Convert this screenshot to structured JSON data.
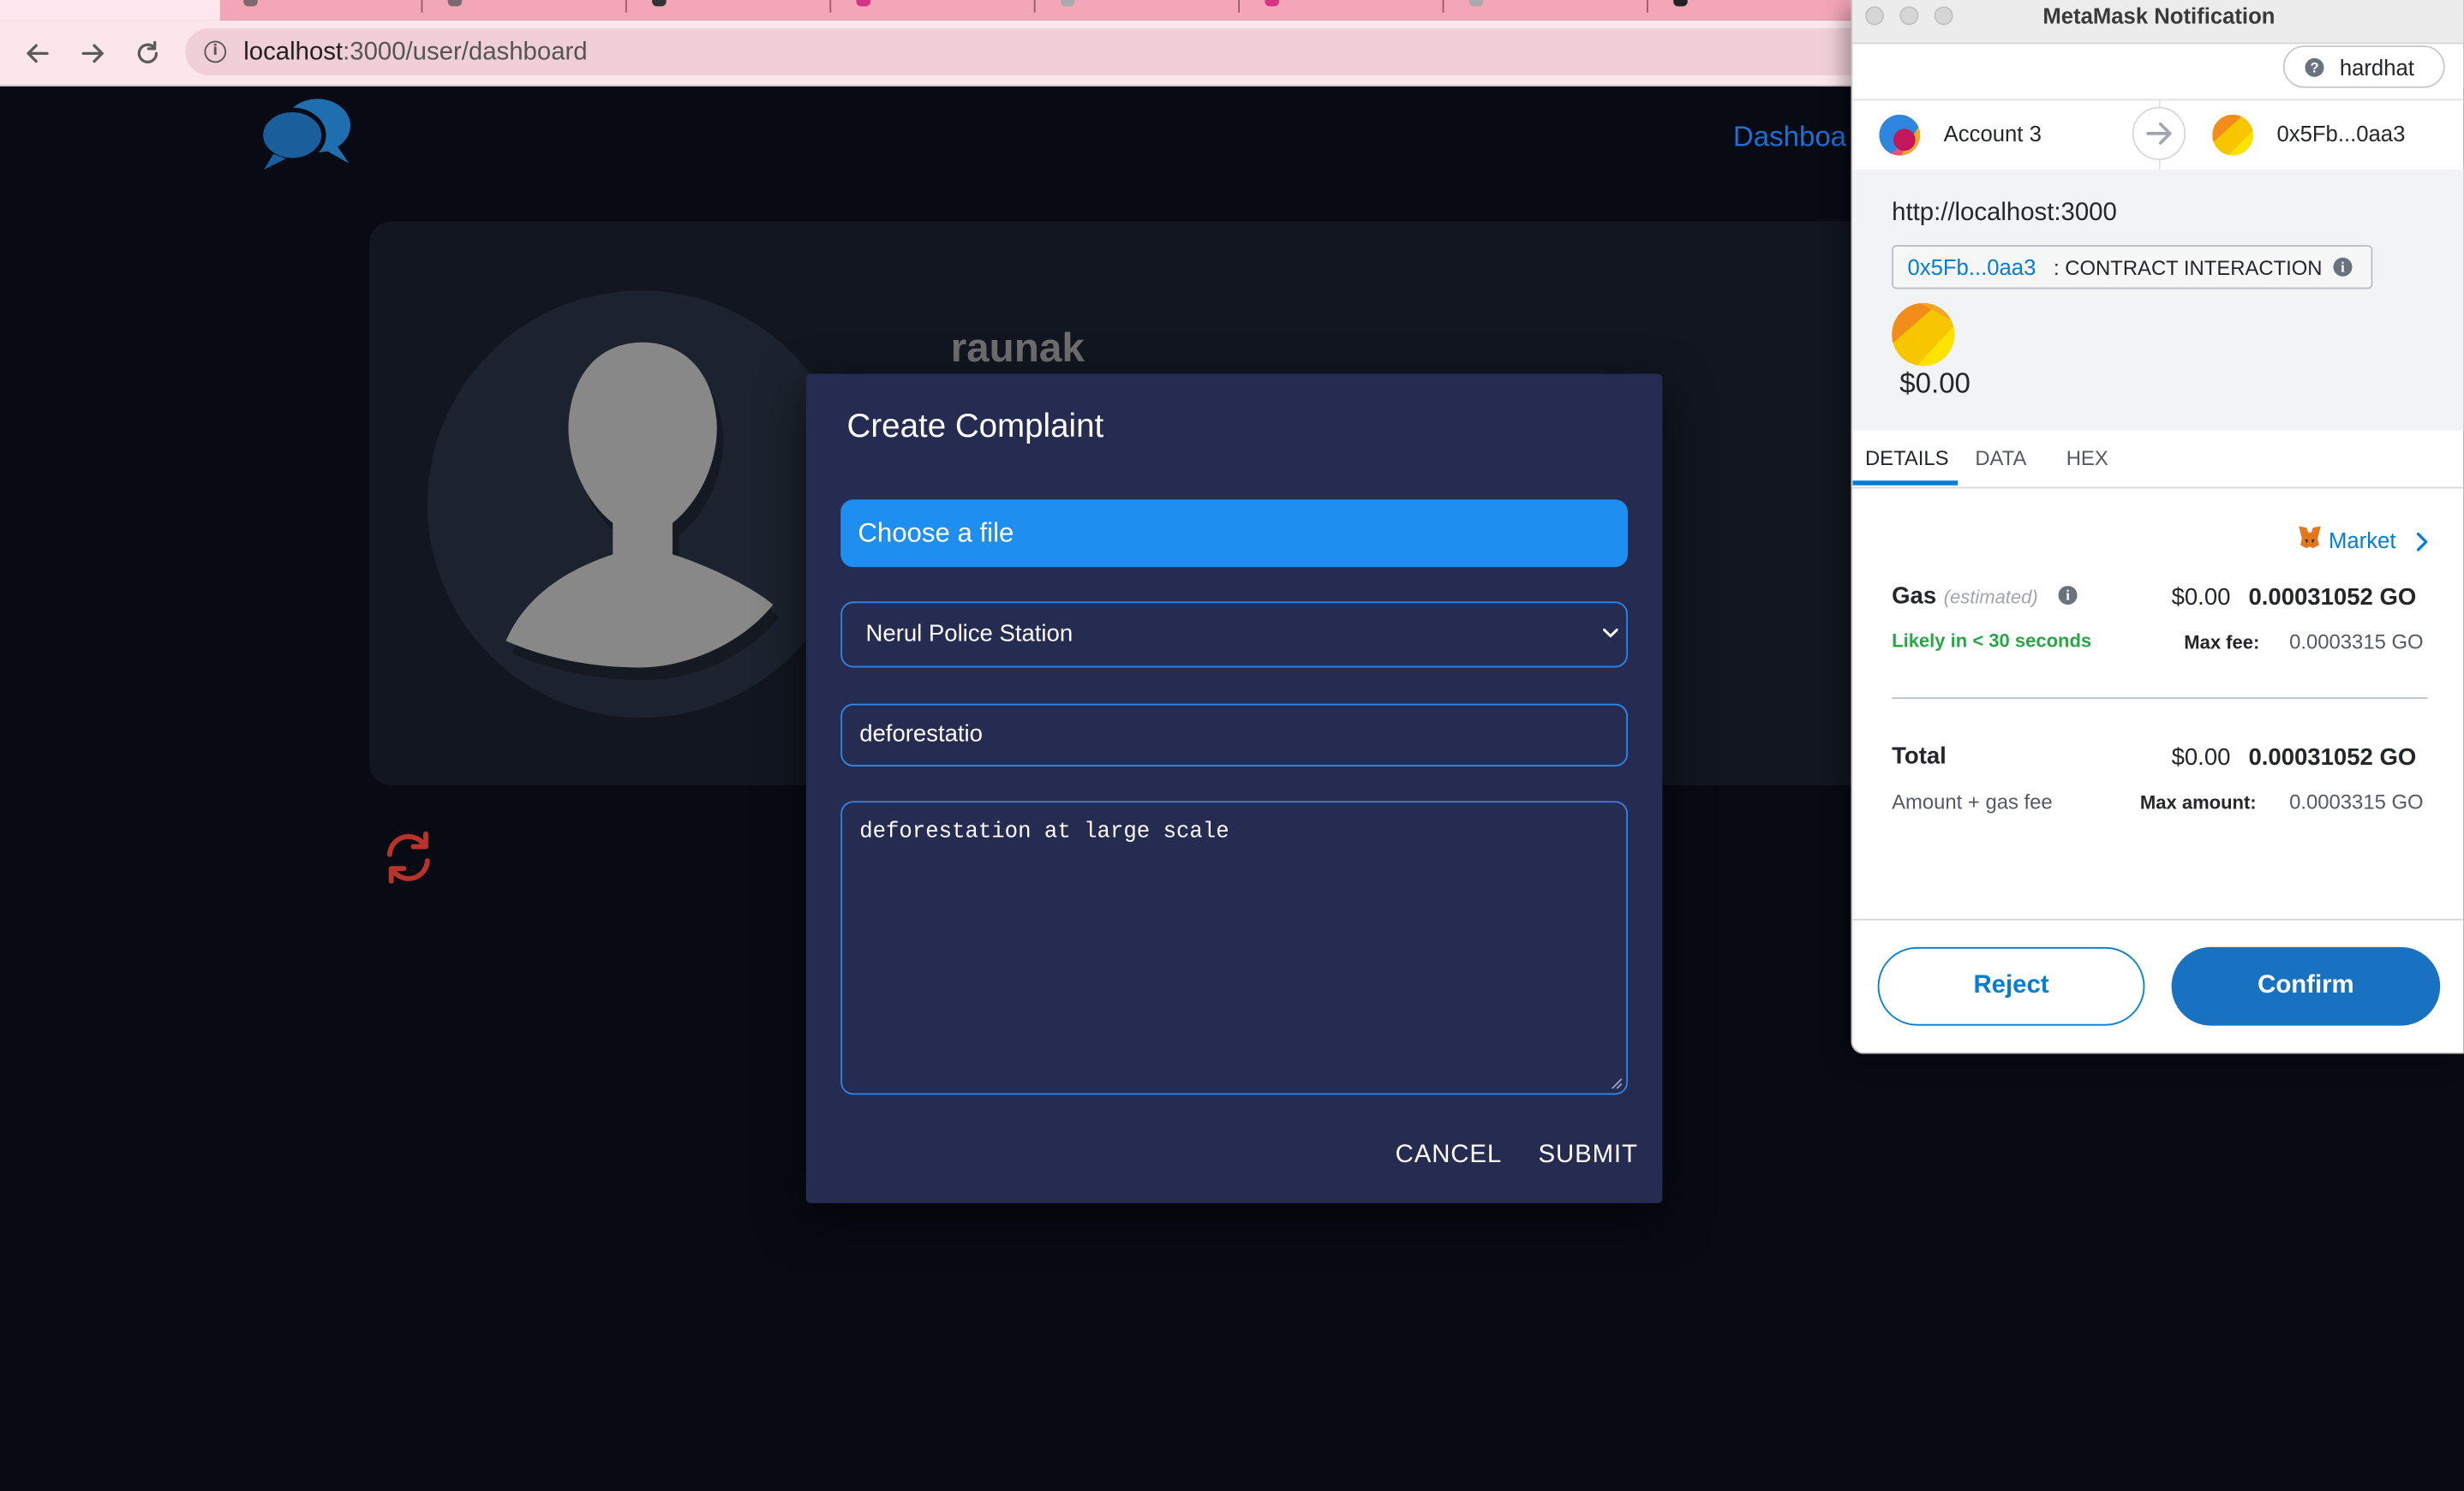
{
  "browser": {
    "url_host": "localhost",
    "url_path": ":3000/user/dashboard"
  },
  "app": {
    "nav_dashboard": "Dashboa",
    "username": "raunak"
  },
  "modal": {
    "title": "Create Complaint",
    "file_button": "Choose a file",
    "police_station": "Nerul Police Station",
    "complaint_title": "deforestatio",
    "description": "deforestation at large scale",
    "cancel": "CANCEL",
    "submit": "SUBMIT"
  },
  "metamask": {
    "window_title": "MetaMask Notification",
    "network": "hardhat",
    "from_account": "Account 3",
    "to_address": "0x5Fb...0aa3",
    "origin": "http://localhost:3000",
    "contract_address": "0x5Fb...0aa3",
    "contract_label": ": CONTRACT INTERACTION",
    "amount": "$0.00",
    "tabs": [
      "DETAILS",
      "DATA",
      "HEX"
    ],
    "market": "Market",
    "gas": {
      "label": "Gas",
      "estimated": "(estimated)",
      "fiat": "$0.00",
      "eth": "0.00031052 GO",
      "likely": "Likely in < 30 seconds",
      "max_fee_label": "Max fee:",
      "max_fee": "0.0003315 GO"
    },
    "total": {
      "label": "Total",
      "fiat": "$0.00",
      "eth": "0.00031052 GO",
      "subtext": "Amount + gas fee",
      "max_amount_label": "Max amount:",
      "max_amount": "0.0003315 GO"
    },
    "reject": "Reject",
    "confirm": "Confirm"
  },
  "colors": {
    "accent_blue": "#1e8ef0",
    "modal_bg": "#262b52",
    "metamask_blue": "#037dd6",
    "success_green": "#28a745",
    "refresh_red": "#c0392b"
  }
}
